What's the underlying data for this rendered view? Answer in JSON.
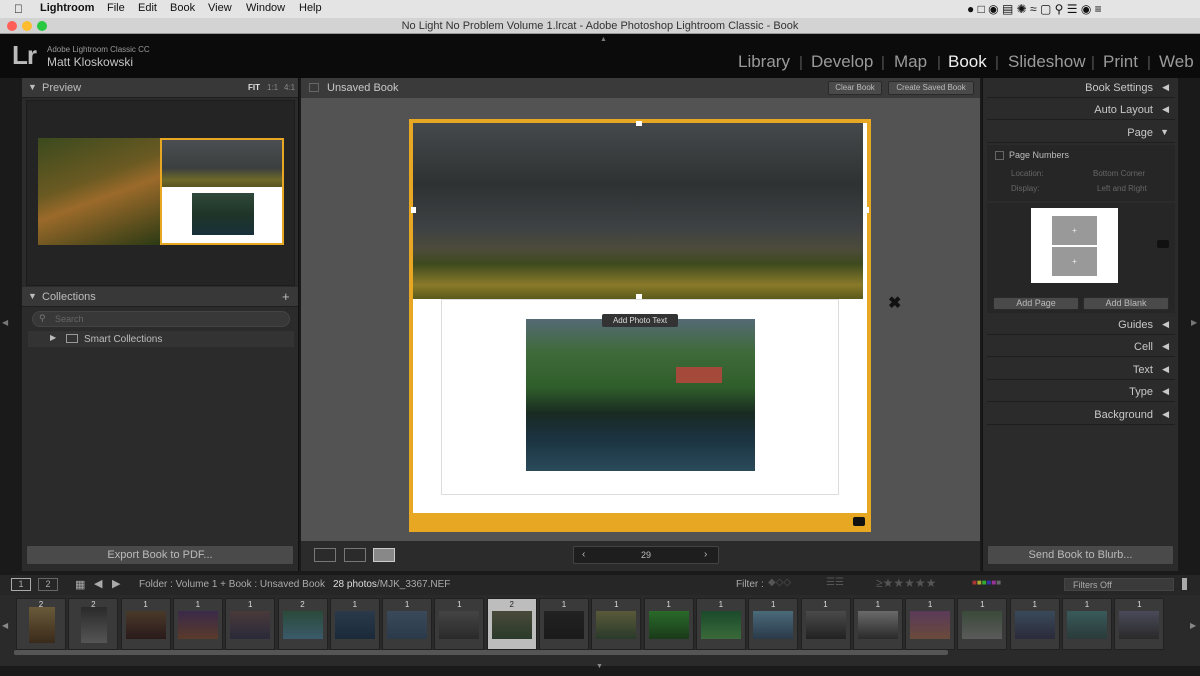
{
  "menubar": {
    "app": "Lightroom",
    "items": [
      "File",
      "Edit",
      "Book",
      "View",
      "Window",
      "Help"
    ]
  },
  "window": {
    "title": "No Light No Problem Volume 1.lrcat - Adobe Photoshop Lightroom Classic - Book"
  },
  "identity": {
    "product": "Adobe Lightroom Classic CC",
    "user": "Matt Kloskowski",
    "logo": "Lr"
  },
  "modules": [
    "Library",
    "Develop",
    "Map",
    "Book",
    "Slideshow",
    "Print",
    "Web"
  ],
  "active_module": "Book",
  "left_panel": {
    "preview": {
      "title": "Preview",
      "zoom_options": [
        "FIT",
        "1:1",
        "4:1"
      ]
    },
    "collections": {
      "title": "Collections",
      "search_placeholder": "Search",
      "items": [
        "Smart Collections"
      ]
    },
    "export_button": "Export Book to PDF..."
  },
  "center": {
    "book_title": "Unsaved Book",
    "clear_button": "Clear Book",
    "create_button": "Create Saved Book",
    "add_photo_text": "Add Photo Text",
    "page_number": "29"
  },
  "right_panel": {
    "sections": [
      "Book Settings",
      "Auto Layout",
      "Page",
      "Guides",
      "Cell",
      "Text",
      "Type",
      "Background"
    ],
    "page_numbers_label": "Page Numbers",
    "location_label": "Location:",
    "location_value": "Bottom Corner",
    "display_label": "Display:",
    "display_value": "Left and Right",
    "add_page": "Add Page",
    "add_blank": "Add Blank",
    "send_button": "Send Book to Blurb..."
  },
  "filmstrip": {
    "source": "Folder : Volume 1  +  Book : Unsaved Book",
    "count": "28 photos",
    "file": "/MJK_3367.NEF",
    "filter_label": "Filter :",
    "filters_value": "Filters Off",
    "page_views": [
      "1",
      "2"
    ],
    "badges": [
      "2",
      "2",
      "1",
      "1",
      "1",
      "2",
      "1",
      "1",
      "1",
      "2",
      "1",
      "1",
      "1",
      "1",
      "1",
      "1",
      "1",
      "1",
      "1",
      "1",
      "1",
      "1"
    ]
  },
  "colors": {
    "accent": "#e8a722",
    "panel": "#2b2b2b",
    "center_bg": "#535353"
  }
}
